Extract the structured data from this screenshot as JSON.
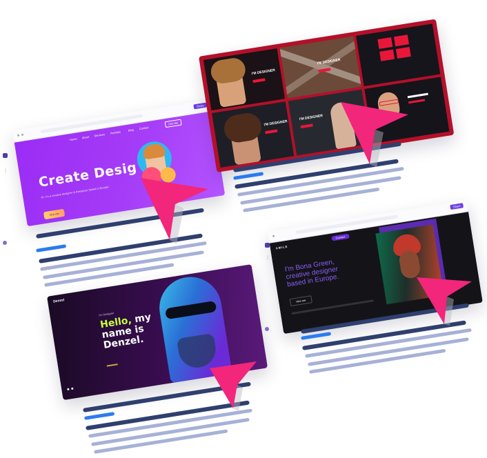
{
  "colors": {
    "purple": "#9b2cf5",
    "pink": "#f2267a",
    "crimson": "#b3102a",
    "navy": "#2f3f6e",
    "lavender": "#a7b1d6",
    "blue": "#2b7bf0",
    "dark": "#141418",
    "violet": "#6a2bd6",
    "neon_green": "#c8ff3c"
  },
  "card1": {
    "headline": "Create Desig",
    "subtext": "Hi, I'm a creative designer & freelancer based in Europe.",
    "cta": "Hire me",
    "nav_button": "Hire Me",
    "nav_items": [
      "Home",
      "About",
      "Services",
      "Portfolio",
      "Blog",
      "Contact"
    ],
    "browser_button": "Share"
  },
  "card2": {
    "tiles": [
      {
        "title": "I'M DESIGNER"
      },
      {
        "title": "I'M DESIGNER"
      },
      {
        "title": "I'M DESIGNER"
      },
      {
        "title": "I'M DESIGNER"
      }
    ]
  },
  "card3": {
    "brand": "Denzel",
    "tagline": "I'm Designer",
    "headline_accent": "Hello,",
    "headline_rest_1": " my",
    "headline_rest_2": "name is",
    "headline_rest_3": "Denzel."
  },
  "card4": {
    "brand": "AMILE",
    "headline_1": "I'm Bona Green,",
    "headline_2": "creative designer",
    "headline_3": "based in Europe.",
    "nav_badge": "Contact",
    "cta": "Hire me",
    "browser_button": "Share"
  }
}
